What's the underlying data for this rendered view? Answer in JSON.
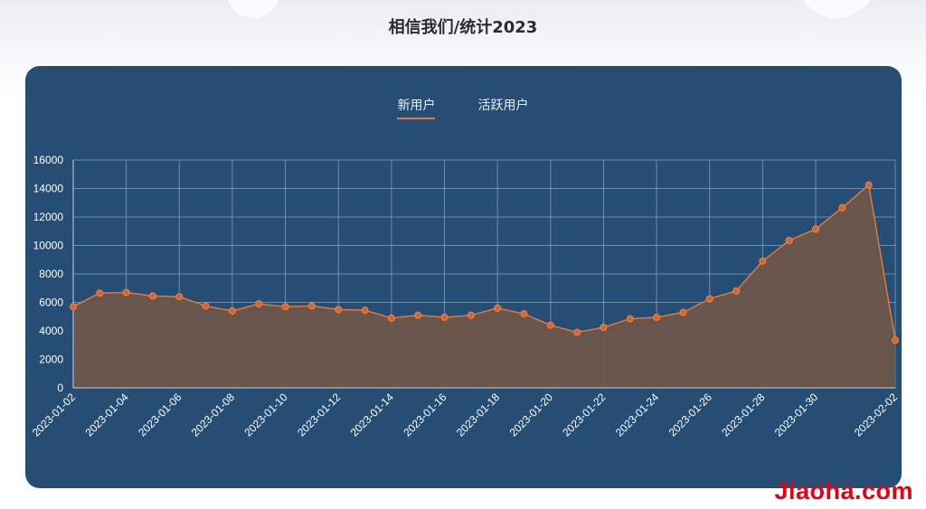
{
  "page": {
    "title": "相信我们/统计2023"
  },
  "tabs": [
    {
      "label": "新用户",
      "active": true
    },
    {
      "label": "活跃用户",
      "active": false
    }
  ],
  "colors": {
    "panel": "#264d73",
    "accent": "#e07a3b",
    "area": "#6b5549",
    "grid": "#8aa2bb"
  },
  "watermark": "Jiaoha.com",
  "chart_data": {
    "type": "area",
    "x": [
      "2023-01-02",
      "2023-01-03",
      "2023-01-04",
      "2023-01-05",
      "2023-01-06",
      "2023-01-07",
      "2023-01-08",
      "2023-01-09",
      "2023-01-10",
      "2023-01-11",
      "2023-01-12",
      "2023-01-13",
      "2023-01-14",
      "2023-01-15",
      "2023-01-16",
      "2023-01-17",
      "2023-01-18",
      "2023-01-19",
      "2023-01-20",
      "2023-01-21",
      "2023-01-22",
      "2023-01-23",
      "2023-01-24",
      "2023-01-25",
      "2023-01-26",
      "2023-01-27",
      "2023-01-28",
      "2023-01-29",
      "2023-01-30",
      "2023-01-31",
      "2023-02-01",
      "2023-02-02"
    ],
    "xtick_labels": [
      "2023-01-02",
      "2023-01-04",
      "2023-01-06",
      "2023-01-08",
      "2023-01-10",
      "2023-01-12",
      "2023-01-14",
      "2023-01-16",
      "2023-01-18",
      "2023-01-20",
      "2023-01-22",
      "2023-01-24",
      "2023-01-26",
      "2023-01-28",
      "2023-01-30",
      "2023-02-02"
    ],
    "series": [
      {
        "values": [
          5700,
          6650,
          6700,
          6450,
          6400,
          5750,
          5400,
          5900,
          5700,
          5750,
          5500,
          5450,
          4900,
          5100,
          4950,
          5100,
          5600,
          5200,
          4400,
          3900,
          4250,
          4850,
          4950,
          5300,
          6250,
          6800,
          8900,
          10350,
          11150,
          12650,
          14250,
          3350
        ]
      }
    ],
    "yticks": [
      0,
      2000,
      4000,
      6000,
      8000,
      10000,
      12000,
      14000,
      16000
    ],
    "ylim": [
      0,
      16000
    ],
    "grid": true
  }
}
